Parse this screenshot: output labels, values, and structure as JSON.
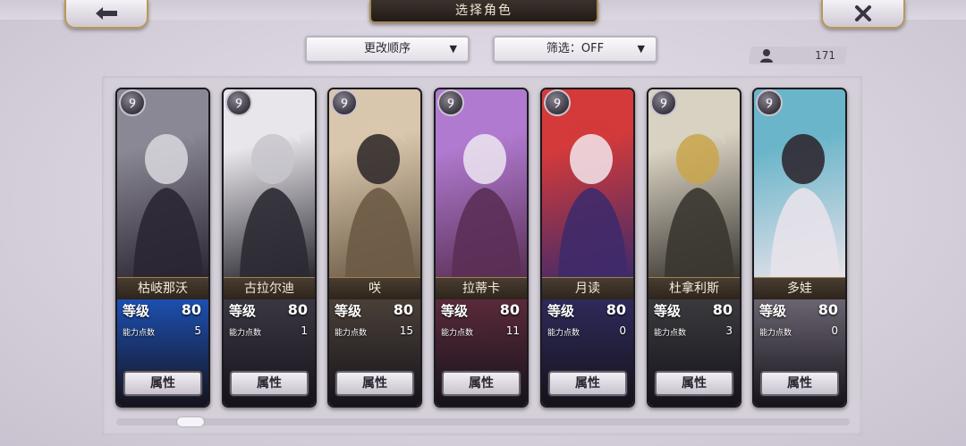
{
  "header": {
    "title": "选择角色"
  },
  "toolbar": {
    "order_label": "更改顺序",
    "filter_label": "筛选：OFF",
    "roster_count": "171"
  },
  "labels": {
    "level": "等级",
    "ability_points": "能力点数",
    "attributes_button": "属性"
  },
  "badge_glyph": "୨",
  "characters": [
    {
      "name": "枯岐那沃",
      "level": "80",
      "ability_points": "5",
      "art_top": "#8a8894",
      "art_bottom": "#2a2632",
      "stat_bg": "#1d4fb0",
      "accent": "#d9d7de"
    },
    {
      "name": "古拉尔迪",
      "level": "80",
      "ability_points": "1",
      "art_top": "#e8e6ea",
      "art_bottom": "#2b2a33",
      "stat_bg": "#3a3742",
      "accent": "#c8c6cc"
    },
    {
      "name": "咲",
      "level": "80",
      "ability_points": "15",
      "art_top": "#d9c7ad",
      "art_bottom": "#6b5a45",
      "stat_bg": "#4a4038",
      "accent": "#2a2426"
    },
    {
      "name": "拉蒂卡",
      "level": "80",
      "ability_points": "11",
      "art_top": "#b07ad0",
      "art_bottom": "#5a2f55",
      "stat_bg": "#5a2a3a",
      "accent": "#ede6f0"
    },
    {
      "name": "月读",
      "level": "80",
      "ability_points": "0",
      "art_top": "#d43a3a",
      "art_bottom": "#3f2a6a",
      "stat_bg": "#2e2a5a",
      "accent": "#f2e8ee"
    },
    {
      "name": "杜拿利斯",
      "level": "80",
      "ability_points": "3",
      "art_top": "#d8d2c2",
      "art_bottom": "#3a3630",
      "stat_bg": "#3a3a3e",
      "accent": "#c9a54a"
    },
    {
      "name": "多娃",
      "level": "80",
      "ability_points": "0",
      "art_top": "#6ab5c9",
      "art_bottom": "#e7e2ea",
      "stat_bg": "#6a6470",
      "accent": "#2a2028"
    }
  ]
}
